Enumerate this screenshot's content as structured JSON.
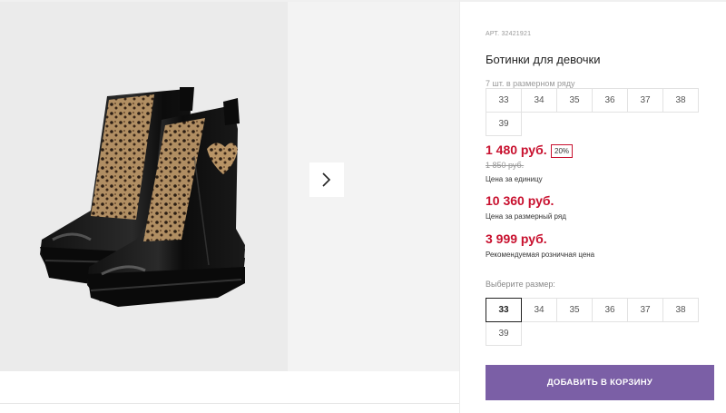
{
  "gallery": {
    "image_alt": "Ботинки для девочки",
    "next_icon": "chevron-right-icon"
  },
  "product": {
    "sku_label": "АРТ.",
    "sku_value": "32421921",
    "title": "Ботинки для девочки",
    "row_note": "7 шт. в размерном ряду",
    "row_sizes": [
      "33",
      "34",
      "35",
      "36",
      "37",
      "38",
      "39"
    ],
    "price_main": "1 480 руб.",
    "discount": "20%",
    "price_old": "1 850 руб.",
    "unit_label": "Цена за единицу",
    "price_row": "10 360 руб.",
    "row_label": "Цена за размерный ряд",
    "price_rec": "3 999 руб.",
    "rec_label": "Рекомендуемая розничная цена",
    "choose_label": "Выберите размер:",
    "pick_sizes": [
      "33",
      "34",
      "35",
      "36",
      "37",
      "38",
      "39"
    ],
    "selected_size": "33",
    "add_button": "ДОБАВИТЬ В КОРЗИНУ"
  },
  "colors": {
    "price_red": "#c8102e",
    "button_purple": "#7b5fa6"
  }
}
